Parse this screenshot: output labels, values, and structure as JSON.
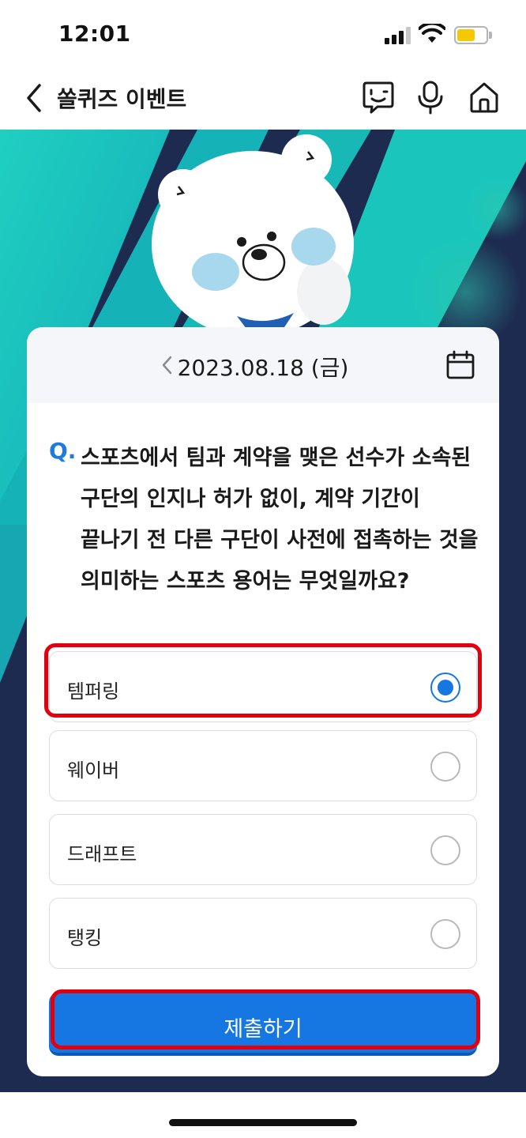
{
  "status_bar": {
    "time": "12:01"
  },
  "nav": {
    "title": "쏠퀴즈 이벤트"
  },
  "quiz": {
    "date": "2023.08.18 (금)",
    "question_prefix": "Q.",
    "question": "스포츠에서 팀과 계약을 맺은 선수가 소속된 구단의 인지나 허가 없이, 계약 기간이 끝나기 전 다른 구단이 사전에 접촉하는 것을 의미하는 스포츠 용어는 무엇일까요?",
    "options": [
      {
        "label": "템퍼링",
        "selected": true
      },
      {
        "label": "웨이버",
        "selected": false
      },
      {
        "label": "드래프트",
        "selected": false
      },
      {
        "label": "탱킹",
        "selected": false
      }
    ],
    "submit_label": "제출하기"
  },
  "colors": {
    "accent": "#1677e3",
    "highlight": "#e2000e",
    "hero_teal": "#19c3b8",
    "hero_navy": "#1c1d45"
  },
  "icons": [
    "back-chevron-icon",
    "chatbot-face-icon",
    "microphone-icon",
    "home-icon",
    "calendar-icon",
    "chevron-left-icon"
  ]
}
